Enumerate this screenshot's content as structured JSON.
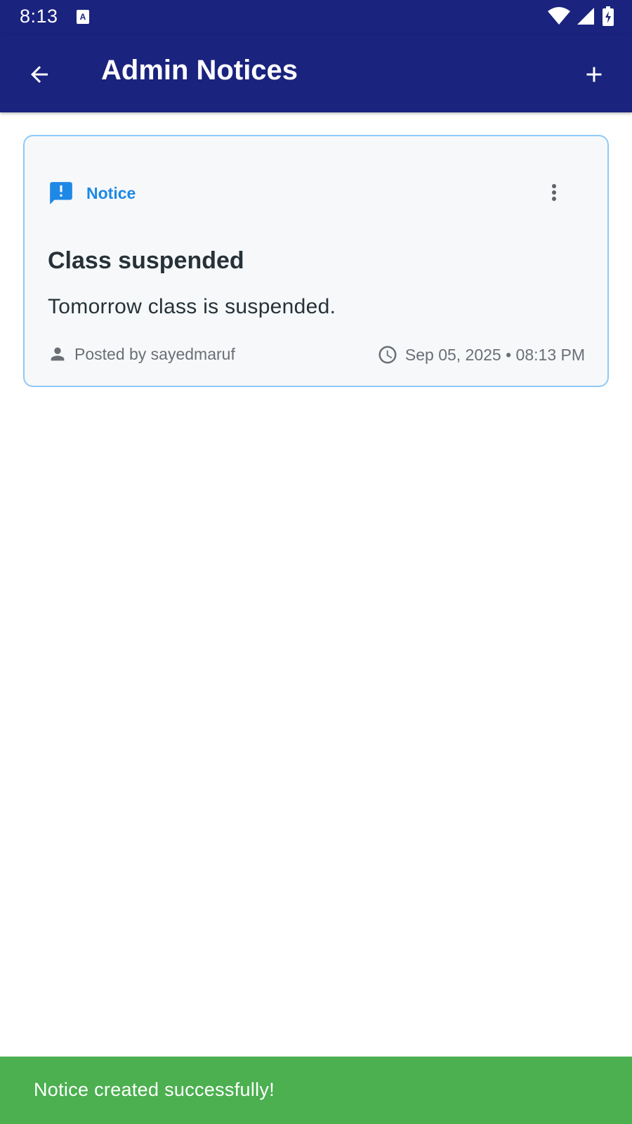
{
  "status_bar": {
    "time": "8:13",
    "icons": [
      "notification-a-icon",
      "wifi-icon",
      "signal-icon",
      "battery-icon"
    ]
  },
  "app_bar": {
    "title": "Admin Notices",
    "back_icon": "arrow-back-icon",
    "add_icon": "plus-icon",
    "background_color": "#1a237e"
  },
  "notices": [
    {
      "category": "Notice",
      "category_icon": "announcement-icon",
      "title": "Class suspended",
      "body": "Tomorrow class is suspended.",
      "author": "Posted by sayedmaruf",
      "datetime": "Sep 05, 2025 • 08:13 PM",
      "accent_color": "#1e88e5"
    }
  ],
  "snackbar": {
    "message": "Notice created successfully!",
    "color": "#4caf50"
  }
}
